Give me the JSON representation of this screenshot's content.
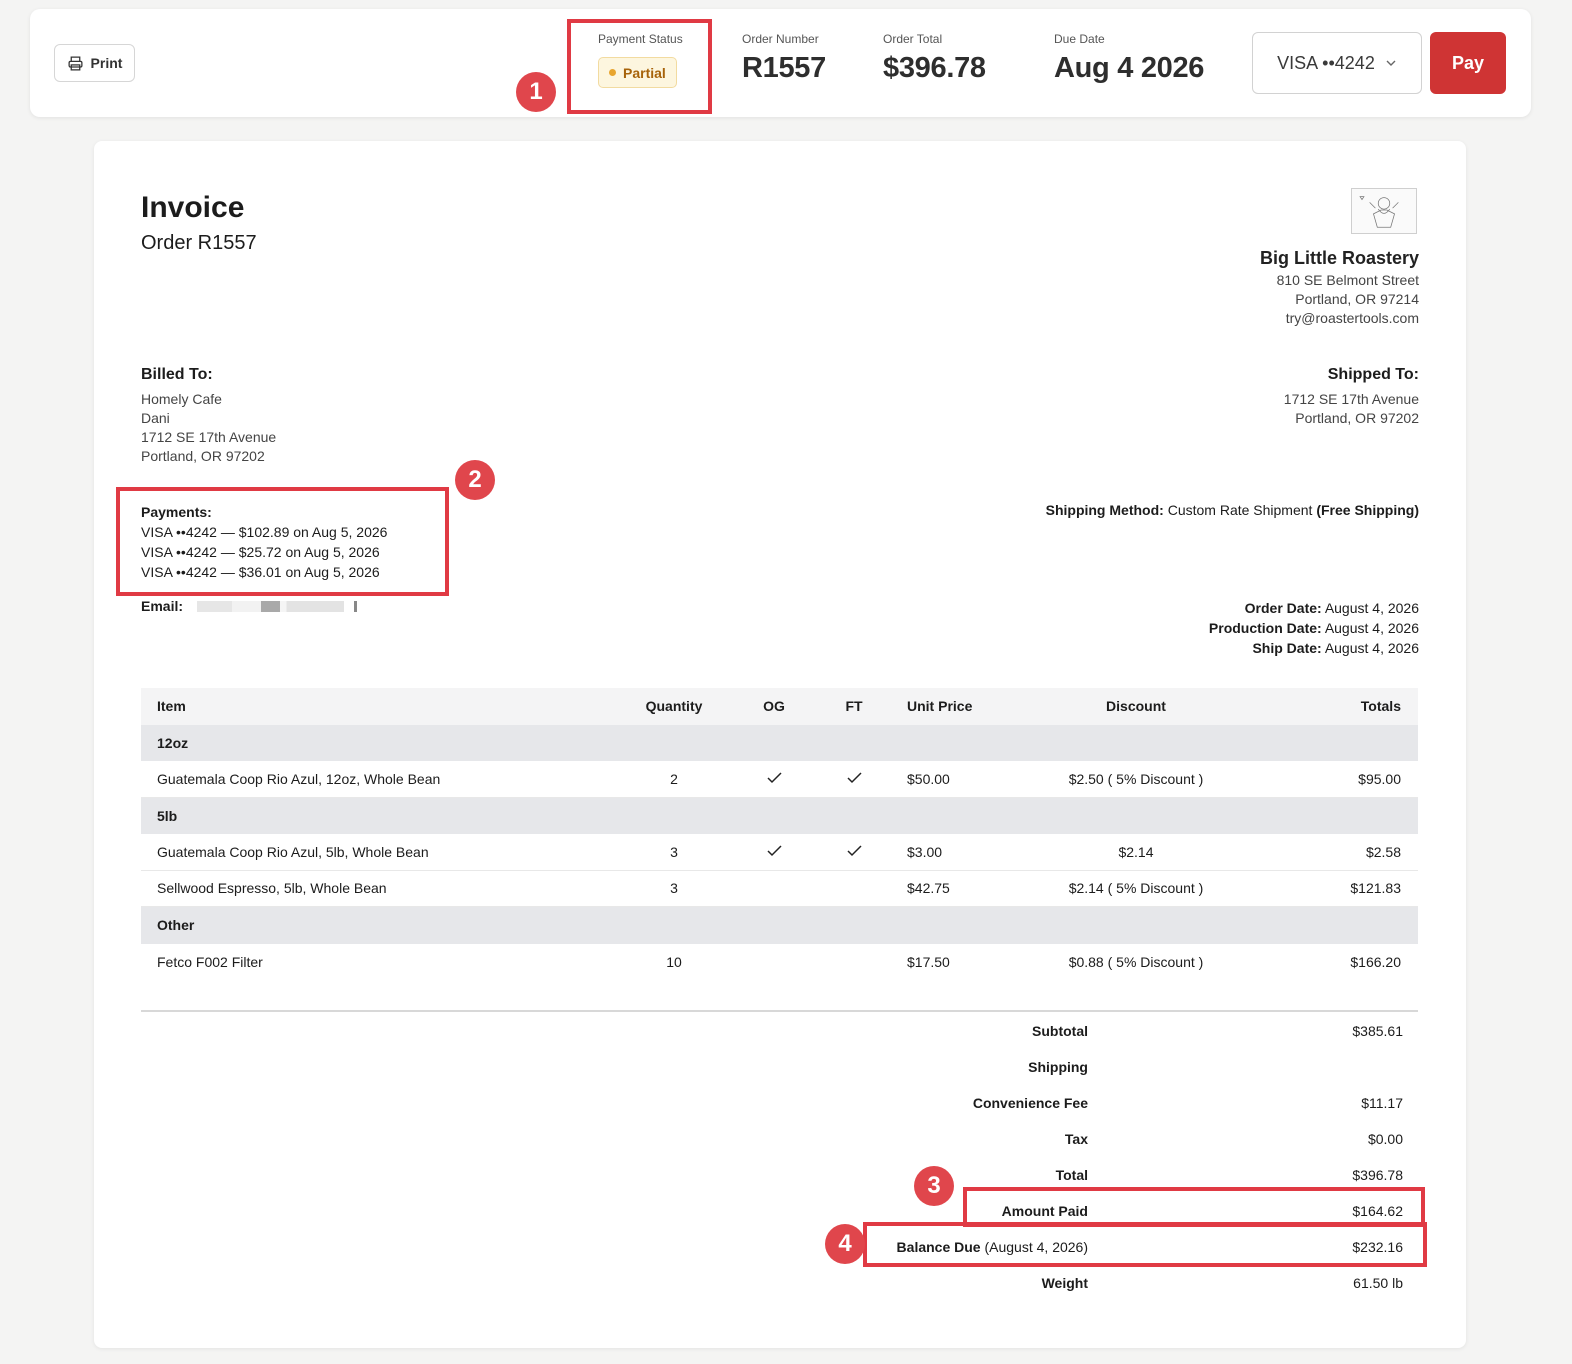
{
  "header": {
    "print_label": "Print",
    "payment_status": {
      "label": "Payment Status",
      "value": "Partial"
    },
    "order_number": {
      "label": "Order Number",
      "value": "R1557"
    },
    "order_total": {
      "label": "Order Total",
      "value": "$396.78"
    },
    "due_date": {
      "label": "Due Date",
      "value": "Aug 4 2026"
    },
    "card_select": "VISA ••4242",
    "pay_label": "Pay"
  },
  "invoice": {
    "title": "Invoice",
    "order": "Order R1557",
    "company": {
      "name": "Big Little Roastery",
      "street": "810 SE Belmont Street",
      "city": "Portland, OR 97214",
      "email": "try@roastertools.com"
    },
    "billed_to": {
      "heading": "Billed To:",
      "lines": [
        "Homely Cafe",
        "Dani",
        "1712 SE 17th Avenue",
        "Portland, OR 97202"
      ]
    },
    "shipped_to": {
      "heading": "Shipped To:",
      "lines": [
        "1712 SE 17th Avenue",
        "Portland, OR 97202"
      ]
    },
    "payments": {
      "heading": "Payments:",
      "lines": [
        "VISA ••4242 — $102.89 on Aug 5, 2026",
        "VISA ••4242 — $25.72 on Aug 5, 2026",
        "VISA ••4242 — $36.01 on Aug 5, 2026"
      ]
    },
    "email_label": "Email:",
    "shipping_method": {
      "label": "Shipping Method:",
      "value": "Custom Rate Shipment",
      "note": "(Free Shipping)"
    },
    "dates": [
      {
        "label": "Order Date:",
        "value": "August 4, 2026"
      },
      {
        "label": "Production Date:",
        "value": "August 4, 2026"
      },
      {
        "label": "Ship Date:",
        "value": "August 4, 2026"
      }
    ],
    "table": {
      "columns": [
        "Item",
        "Quantity",
        "OG",
        "FT",
        "Unit Price",
        "Discount",
        "Totals"
      ],
      "groups": [
        {
          "name": "12oz",
          "items": [
            {
              "item": "Guatemala Coop Rio Azul, 12oz, Whole Bean",
              "qty": "2",
              "og": true,
              "ft": true,
              "unit": "$50.00",
              "discount": "$2.50 ( 5% Discount )",
              "total": "$95.00"
            }
          ]
        },
        {
          "name": "5lb",
          "items": [
            {
              "item": "Guatemala Coop Rio Azul, 5lb, Whole Bean",
              "qty": "3",
              "og": true,
              "ft": true,
              "unit": "$3.00",
              "discount": "$2.14",
              "total": "$2.58"
            },
            {
              "item": "Sellwood Espresso, 5lb, Whole Bean",
              "qty": "3",
              "og": false,
              "ft": false,
              "unit": "$42.75",
              "discount": "$2.14 ( 5% Discount )",
              "total": "$121.83"
            }
          ]
        },
        {
          "name": "Other",
          "items": [
            {
              "item": "Fetco F002 Filter",
              "qty": "10",
              "og": false,
              "ft": false,
              "unit": "$17.50",
              "discount": "$0.88 ( 5% Discount )",
              "total": "$166.20"
            }
          ]
        }
      ]
    },
    "totals": {
      "subtotal": {
        "label": "Subtotal",
        "value": "$385.61"
      },
      "shipping": {
        "label": "Shipping",
        "value": ""
      },
      "convenience_fee": {
        "label": "Convenience Fee",
        "value": "$11.17"
      },
      "tax": {
        "label": "Tax",
        "value": "$0.00"
      },
      "total": {
        "label": "Total",
        "value": "$396.78"
      },
      "amount_paid": {
        "label": "Amount Paid",
        "value": "$164.62"
      },
      "balance_due": {
        "label": "Balance Due",
        "note": "(August 4, 2026)",
        "value": "$232.16"
      },
      "weight": {
        "label": "Weight",
        "value": "61.50 lb"
      }
    }
  },
  "annotations": [
    "1",
    "2",
    "3",
    "4"
  ],
  "colors": {
    "accent": "#cf3434",
    "highlight": "#e03a44",
    "partial_badge": "#a7630a"
  }
}
